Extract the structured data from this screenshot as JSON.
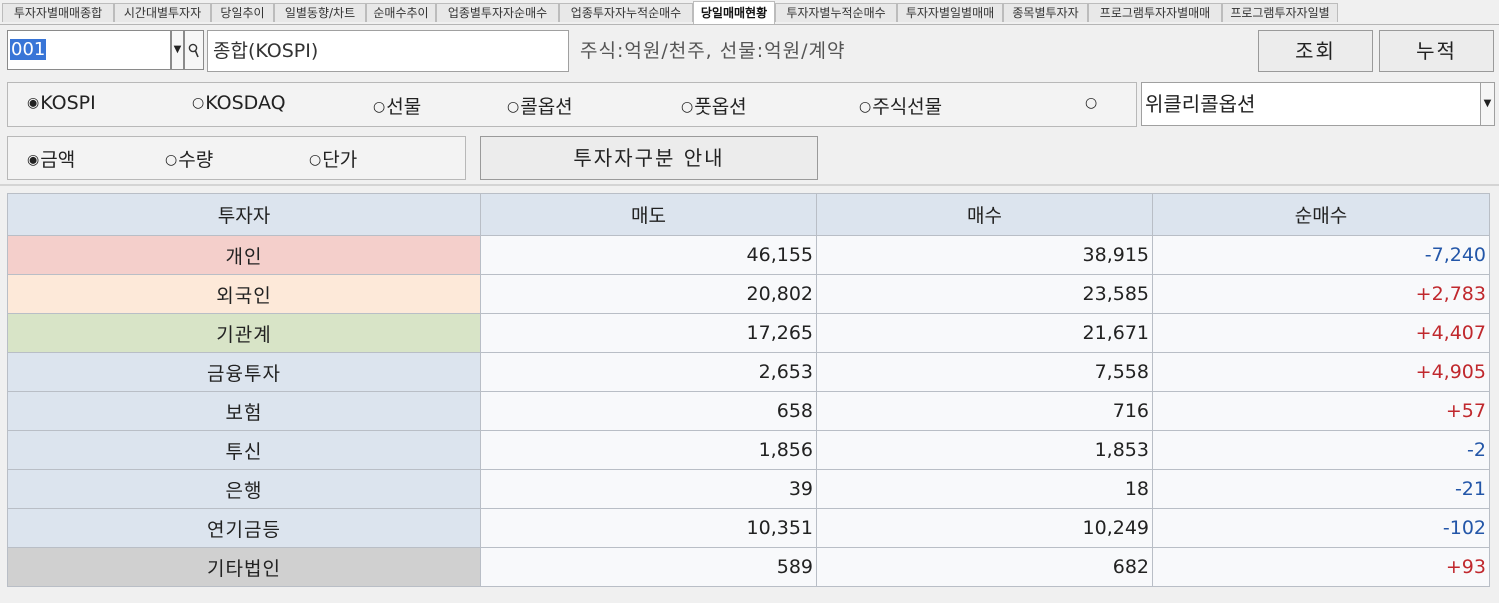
{
  "tabs": [
    {
      "label": "투자자별매매종합",
      "active": false
    },
    {
      "label": "시간대별투자자",
      "active": false
    },
    {
      "label": "당일추이",
      "active": false
    },
    {
      "label": "일별동향/차트",
      "active": false
    },
    {
      "label": "순매수추이",
      "active": false
    },
    {
      "label": "업종별투자자순매수",
      "active": false
    },
    {
      "label": "업종투자자누적순매수",
      "active": false
    },
    {
      "label": "당일매매현황",
      "active": true
    },
    {
      "label": "투자자별누적순매수",
      "active": false
    },
    {
      "label": "투자자별일별매매",
      "active": false
    },
    {
      "label": "종목별투자자",
      "active": false
    },
    {
      "label": "프로그램투자자별매매",
      "active": false
    },
    {
      "label": "프로그램투자자일별",
      "active": false
    }
  ],
  "toolbar": {
    "code_value": "001",
    "dropdown_glyph": "▼",
    "name_value": "종합(KOSPI)",
    "unit_text": "주식:억원/천주, 선물:억원/계약",
    "query_label": "조회",
    "cumulative_label": "누적"
  },
  "market": {
    "options": [
      {
        "label": "KOSPI",
        "selected": true
      },
      {
        "label": "KOSDAQ",
        "selected": false
      },
      {
        "label": "선물",
        "selected": false
      },
      {
        "label": "콜옵션",
        "selected": false
      },
      {
        "label": "풋옵션",
        "selected": false
      },
      {
        "label": "주식선물",
        "selected": false
      },
      {
        "label": "",
        "selected": false
      }
    ],
    "option_select_value": "위클리콜옵션",
    "dropdown_glyph": "▼"
  },
  "mode": {
    "options": [
      {
        "label": "금액",
        "selected": true
      },
      {
        "label": "수량",
        "selected": false
      },
      {
        "label": "단가",
        "selected": false
      }
    ],
    "guide_label": "투자자구분 안내"
  },
  "radio_glyph_on": "◉",
  "radio_glyph_off": "○",
  "table": {
    "headers": [
      "투자자",
      "매도",
      "매수",
      "순매수"
    ],
    "rows": [
      {
        "name": "개인",
        "sell": "46,155",
        "buy": "38,915",
        "net": "-7,240",
        "sign": "neg",
        "color": "#f4cfcb"
      },
      {
        "name": "외국인",
        "sell": "20,802",
        "buy": "23,585",
        "net": "+2,783",
        "sign": "pos",
        "color": "#fde9d9"
      },
      {
        "name": "기관계",
        "sell": "17,265",
        "buy": "21,671",
        "net": "+4,407",
        "sign": "pos",
        "color": "#d8e4c7"
      },
      {
        "name": "금융투자",
        "sell": "2,653",
        "buy": "7,558",
        "net": "+4,905",
        "sign": "pos",
        "color": "#dce4ee"
      },
      {
        "name": "보험",
        "sell": "658",
        "buy": "716",
        "net": "+57",
        "sign": "pos",
        "color": "#dce4ee"
      },
      {
        "name": "투신",
        "sell": "1,856",
        "buy": "1,853",
        "net": "-2",
        "sign": "neg",
        "color": "#dce4ee"
      },
      {
        "name": "은행",
        "sell": "39",
        "buy": "18",
        "net": "-21",
        "sign": "neg",
        "color": "#dce4ee"
      },
      {
        "name": "연기금등",
        "sell": "10,351",
        "buy": "10,249",
        "net": "-102",
        "sign": "neg",
        "color": "#dce4ee"
      },
      {
        "name": "기타법인",
        "sell": "589",
        "buy": "682",
        "net": "+93",
        "sign": "pos",
        "color": "#d0d0d0"
      }
    ]
  }
}
